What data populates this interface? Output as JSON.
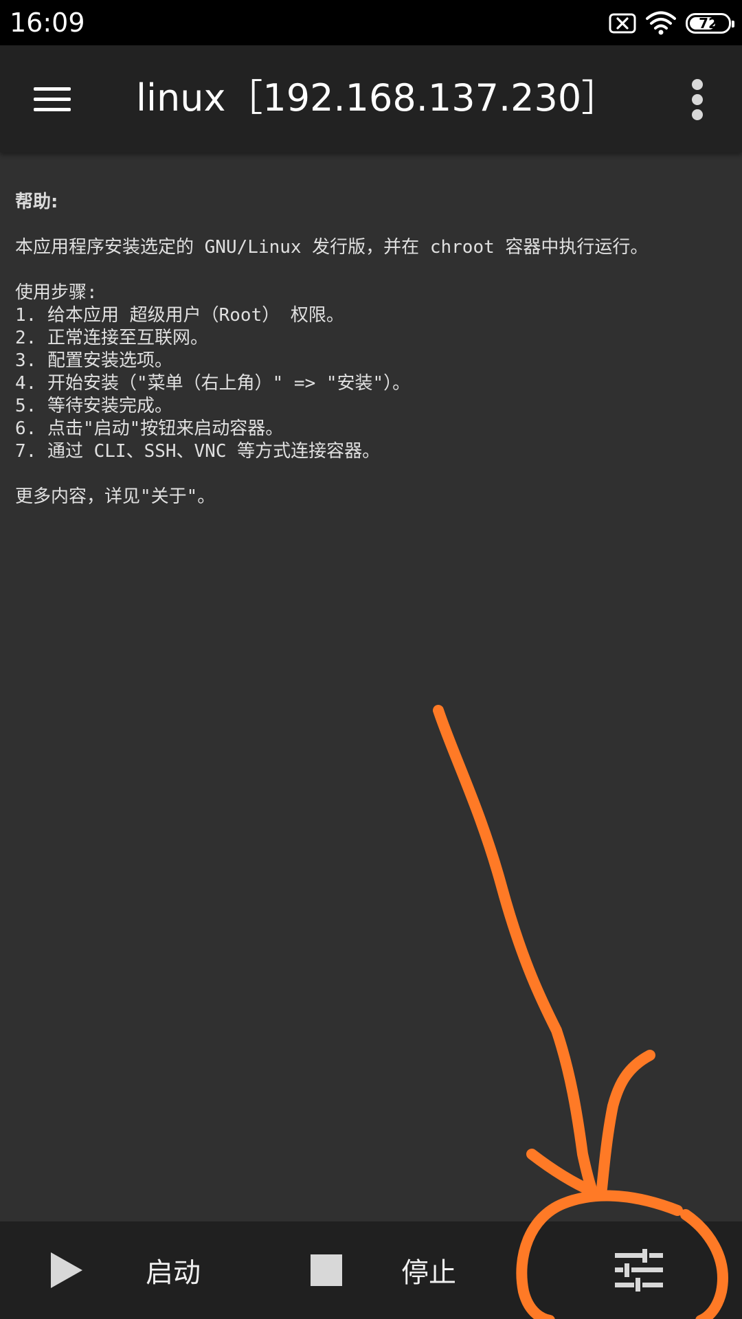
{
  "status_bar": {
    "time": "16:09",
    "battery_level": "72",
    "battery_fraction": 0.72
  },
  "app_bar": {
    "title": "linux［192.168.137.230］"
  },
  "help": {
    "heading": "帮助:",
    "intro": "本应用程序安装选定的 GNU/Linux 发行版，并在 chroot 容器中执行运行。",
    "steps_title": "使用步骤:",
    "steps": [
      "1. 给本应用 超级用户（Root） 权限。",
      "2. 正常连接至互联网。",
      "3. 配置安装选项。",
      "4. 开始安装（\"菜单（右上角）\" => \"安装\"）。",
      "5. 等待安装完成。",
      "6. 点击\"启动\"按钮来启动容器。",
      "7. 通过 CLI、SSH、VNC 等方式连接容器。"
    ],
    "more": "更多内容，详见\"关于\"。"
  },
  "bottom_bar": {
    "start_label": "启动",
    "stop_label": "停止"
  },
  "colors": {
    "background": "#303030",
    "app_bar": "#222222",
    "bottom_bar": "#202020",
    "annotation": "#ff7a26"
  },
  "icons": {
    "menu": "hamburger-menu-icon",
    "overflow": "more-vert-icon",
    "start": "play-icon",
    "stop": "stop-icon",
    "settings": "tune-sliders-icon",
    "wifi": "wifi-icon",
    "sim": "sim-x-icon"
  }
}
